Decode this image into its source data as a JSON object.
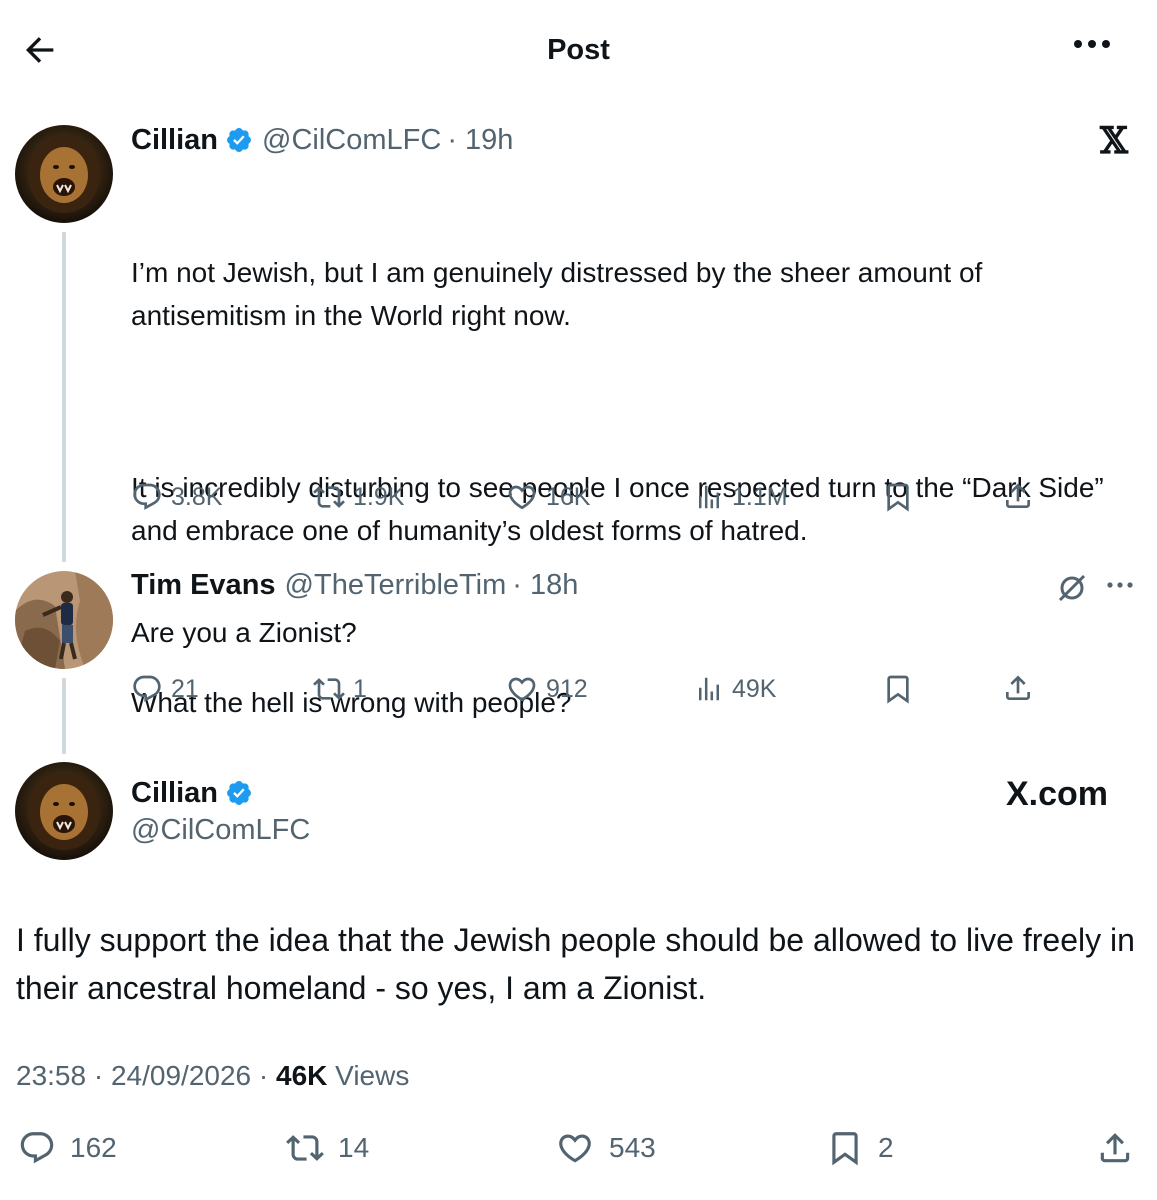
{
  "header": {
    "title": "Post"
  },
  "tweet1": {
    "name": "Cillian",
    "handle": "@CilComLFC",
    "time": "· 19h",
    "paragraphs": [
      "I’m not Jewish, but I am genuinely distressed by the sheer amount of antisemitism in the World right now.",
      "It is incredibly disturbing to see people I once respected turn to the “Dark Side” and embrace one of humanity’s oldest forms of hatred.",
      "What the hell is wrong with people?"
    ],
    "stats": {
      "replies": "3.8K",
      "reposts": "1.9K",
      "likes": "16K",
      "views": "1.1M"
    }
  },
  "tweet2": {
    "name": "Tim Evans",
    "handle": "@TheTerribleTim",
    "time": "· 18h",
    "text": "Are you a Zionist?",
    "stats": {
      "replies": "21",
      "reposts": "1",
      "likes": "912",
      "views": "49K"
    }
  },
  "main": {
    "name": "Cillian",
    "handle": "@CilComLFC",
    "brand": "X.com",
    "text": "I fully support the idea that the Jewish people should be allowed to live freely in their ancestral homeland - so yes, I am a Zionist.",
    "time": "23:58",
    "date": "24/09/2026",
    "views_count": "46K",
    "views_label": "Views",
    "stats": {
      "replies": "162",
      "reposts": "14",
      "likes": "543",
      "bookmarks": "2"
    }
  },
  "colors": {
    "verified": "#1d9bf0",
    "secondary_text": "#536471",
    "thread_line": "#cfd9de"
  }
}
